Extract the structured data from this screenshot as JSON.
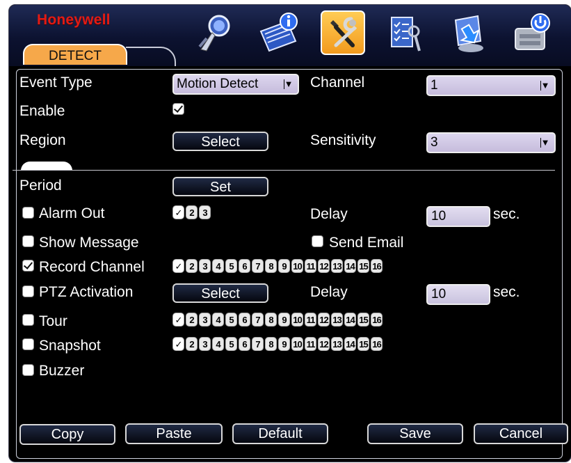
{
  "brand": "Honeywell",
  "tab": "DETECT",
  "toolbar": [
    {
      "name": "search-icon"
    },
    {
      "name": "info-icon"
    },
    {
      "name": "tools-icon"
    },
    {
      "name": "checklist-icon"
    },
    {
      "name": "backup-icon"
    },
    {
      "name": "shutdown-icon"
    }
  ],
  "form": {
    "event_type_label": "Event Type",
    "event_type_value": "Motion Detect",
    "channel_label": "Channel",
    "channel_value": "1",
    "enable_label": "Enable",
    "enable_checked": true,
    "region_label": "Region",
    "region_button": "Select",
    "sensitivity_label": "Sensitivity",
    "sensitivity_value": "3",
    "period_label": "Period",
    "period_button": "Set",
    "alarm_out_label": "Alarm Out",
    "alarm_out_checked": false,
    "alarm_out_channels": [
      "✓",
      "2",
      "3"
    ],
    "delay_label": "Delay",
    "delay_value": "10",
    "sec_label": "sec.",
    "show_message_label": "Show Message",
    "show_message_checked": false,
    "send_email_label": "Send Email",
    "send_email_checked": false,
    "record_channel_label": "Record Channel",
    "record_channel_checked": true,
    "ptz_label": "PTZ Activation",
    "ptz_checked": false,
    "ptz_button": "Select",
    "ptz_delay_label": "Delay",
    "ptz_delay_value": "10",
    "ptz_sec_label": "sec.",
    "tour_label": "Tour",
    "tour_checked": false,
    "snapshot_label": "Snapshot",
    "snapshot_checked": false,
    "buzzer_label": "Buzzer",
    "buzzer_checked": false,
    "channels16": [
      "✓",
      "2",
      "3",
      "4",
      "5",
      "6",
      "7",
      "8",
      "9",
      "10",
      "11",
      "12",
      "13",
      "14",
      "15",
      "16"
    ]
  },
  "buttons": {
    "copy": "Copy",
    "paste": "Paste",
    "default": "Default",
    "save": "Save",
    "cancel": "Cancel"
  },
  "colors": {
    "brand_red": "#e21b14",
    "tab_orange": "#f6a84a",
    "panel_bg": "#000000"
  }
}
